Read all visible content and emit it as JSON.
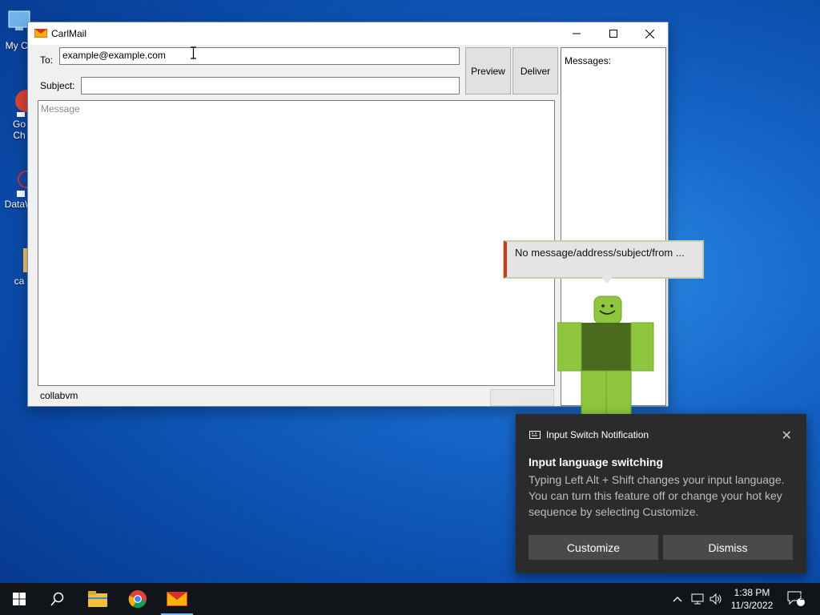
{
  "desktop": {
    "icons": [
      {
        "label": "My Co",
        "icon": "computer-icon"
      },
      {
        "label": "Go\nCh",
        "icon": "chrome-shortcut-icon"
      },
      {
        "label": "DataW",
        "icon": "datawiz-shortcut-icon"
      },
      {
        "label": "ca",
        "icon": "folder-icon"
      }
    ]
  },
  "window": {
    "title": "CarlMail",
    "controls": {
      "minimize": "minimize-icon",
      "maximize": "maximize-icon",
      "close": "close-icon"
    },
    "to_label": "To:",
    "to_value": "example@example.com",
    "subject_label": "Subject:",
    "subject_value": "",
    "message_placeholder": "Message",
    "preview_label": "Preview",
    "deliver_label": "Deliver",
    "messages_label": "Messages:",
    "status_text": "collabvm"
  },
  "balloon": {
    "text": "No message/address/subject/from ...",
    "accent": "#c83a2a"
  },
  "toast": {
    "header": "Input Switch Notification",
    "heading": "Input language switching",
    "body": "Typing Left Alt + Shift changes your input language. You can turn this feature off or change your hot key sequence by selecting Customize.",
    "customize_label": "Customize",
    "dismiss_label": "Dismiss"
  },
  "taskbar": {
    "time": "1:38 PM",
    "date": "11/3/2022",
    "notification_count": "1",
    "pinned": [
      "start-icon",
      "search-icon",
      "file-explorer-icon",
      "chrome-icon",
      "carlmail-icon"
    ]
  },
  "colors": {
    "accent_blue": "#76b9ed",
    "gmail_red": "#d93025",
    "toast_bg": "#2b2b2b"
  }
}
